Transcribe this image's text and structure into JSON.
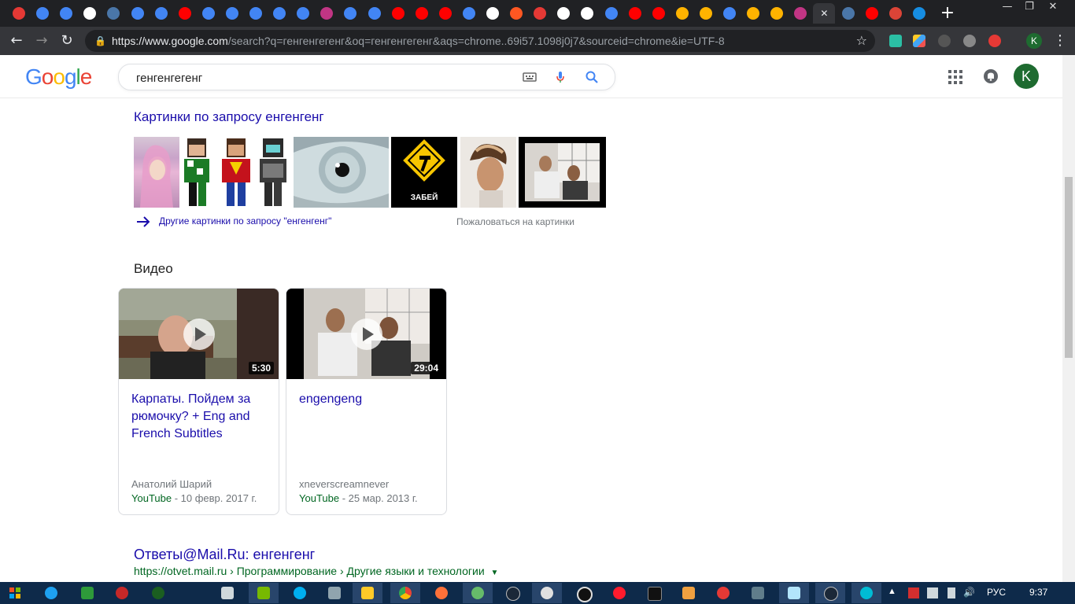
{
  "browser": {
    "tabs": [
      {
        "icon": "youtube-icon",
        "color": "#e53935"
      },
      {
        "icon": "google-icon",
        "color": "#4285f4"
      },
      {
        "icon": "google-icon",
        "color": "#4285f4"
      },
      {
        "icon": "wikipedia-icon",
        "color": "#ffffff"
      },
      {
        "icon": "vk-icon",
        "color": "#4a76a8"
      },
      {
        "icon": "google-icon",
        "color": "#4285f4"
      },
      {
        "icon": "google-icon",
        "color": "#4285f4"
      },
      {
        "icon": "youtube-icon",
        "color": "#ff0000"
      },
      {
        "icon": "google-icon",
        "color": "#4285f4"
      },
      {
        "icon": "google-icon",
        "color": "#4285f4"
      },
      {
        "icon": "google-icon",
        "color": "#4285f4"
      },
      {
        "icon": "google-icon",
        "color": "#4285f4"
      },
      {
        "icon": "google-icon",
        "color": "#4285f4"
      },
      {
        "icon": "instagram-icon",
        "color": "#c13584"
      },
      {
        "icon": "google-icon",
        "color": "#4285f4"
      },
      {
        "icon": "google-icon",
        "color": "#4285f4"
      },
      {
        "icon": "youtube-icon",
        "color": "#ff0000"
      },
      {
        "icon": "youtube-icon",
        "color": "#ff0000"
      },
      {
        "icon": "youtube-icon",
        "color": "#ff0000"
      },
      {
        "icon": "google-icon",
        "color": "#4285f4"
      },
      {
        "icon": "document-icon",
        "color": "#ffffff"
      },
      {
        "icon": "flame-icon",
        "color": "#ff5722"
      },
      {
        "icon": "hd-icon",
        "color": "#e53935"
      },
      {
        "icon": "s-logo-icon",
        "color": "#ffffff"
      },
      {
        "icon": "image-icon",
        "color": "#ffffff"
      },
      {
        "icon": "google-icon",
        "color": "#4285f4"
      },
      {
        "icon": "youtube-icon",
        "color": "#ff0000"
      },
      {
        "icon": "youtube-icon",
        "color": "#ff0000"
      },
      {
        "icon": "bolt-icon",
        "color": "#ffb300"
      },
      {
        "icon": "bolt-icon",
        "color": "#ffb300"
      },
      {
        "icon": "google-icon",
        "color": "#4285f4"
      },
      {
        "icon": "bolt-icon",
        "color": "#ffb300"
      },
      {
        "icon": "bolt-icon",
        "color": "#ffb300"
      },
      {
        "icon": "instagram-icon",
        "color": "#c13584"
      },
      {
        "icon": "close-icon",
        "color": "#e8eaed",
        "active": true
      },
      {
        "icon": "vk-icon",
        "color": "#4a76a8"
      },
      {
        "icon": "youtube-icon",
        "color": "#ff0000"
      },
      {
        "icon": "google-plus-icon",
        "color": "#db4437"
      },
      {
        "icon": "mail-at-icon",
        "color": "#168de2"
      }
    ],
    "url_domain": "https://www.google.com",
    "url_path": "/search?q=генгенгегенг&oq=генгенгегенг&aqs=chrome..69i57.1098j0j7&sourceid=chrome&ie=UTF-8",
    "profile_initial": "K"
  },
  "google": {
    "logo": "Google",
    "query": "генгенгегенг",
    "avatar_initial": "K"
  },
  "images": {
    "heading": "Картинки по запросу енгенгенг",
    "more_link": "Другие картинки по запросу \"енгенгенг\"",
    "report": "Пожаловаться на картинки",
    "sign_text": "ЗАБЕЙ"
  },
  "videos": {
    "heading": "Видео",
    "items": [
      {
        "title": "Карпаты. Пойдем за рюмочку? + Eng and French Subtitles",
        "duration": "5:30",
        "author": "Анатолий Шарий",
        "source": "YouTube",
        "date": " - 10 февр. 2017 г."
      },
      {
        "title": "engengeng",
        "duration": "29:04",
        "author": "xneverscreamnever",
        "source": "YouTube",
        "date": " - 25 мар. 2013 г."
      }
    ]
  },
  "result": {
    "title": "Ответы@Mail.Ru: енгенгенг",
    "breadcrumb": "https://otvet.mail.ru › Программирование › Другие языки и технологии"
  },
  "taskbar": {
    "lang": "РУС",
    "time": "9:37"
  }
}
